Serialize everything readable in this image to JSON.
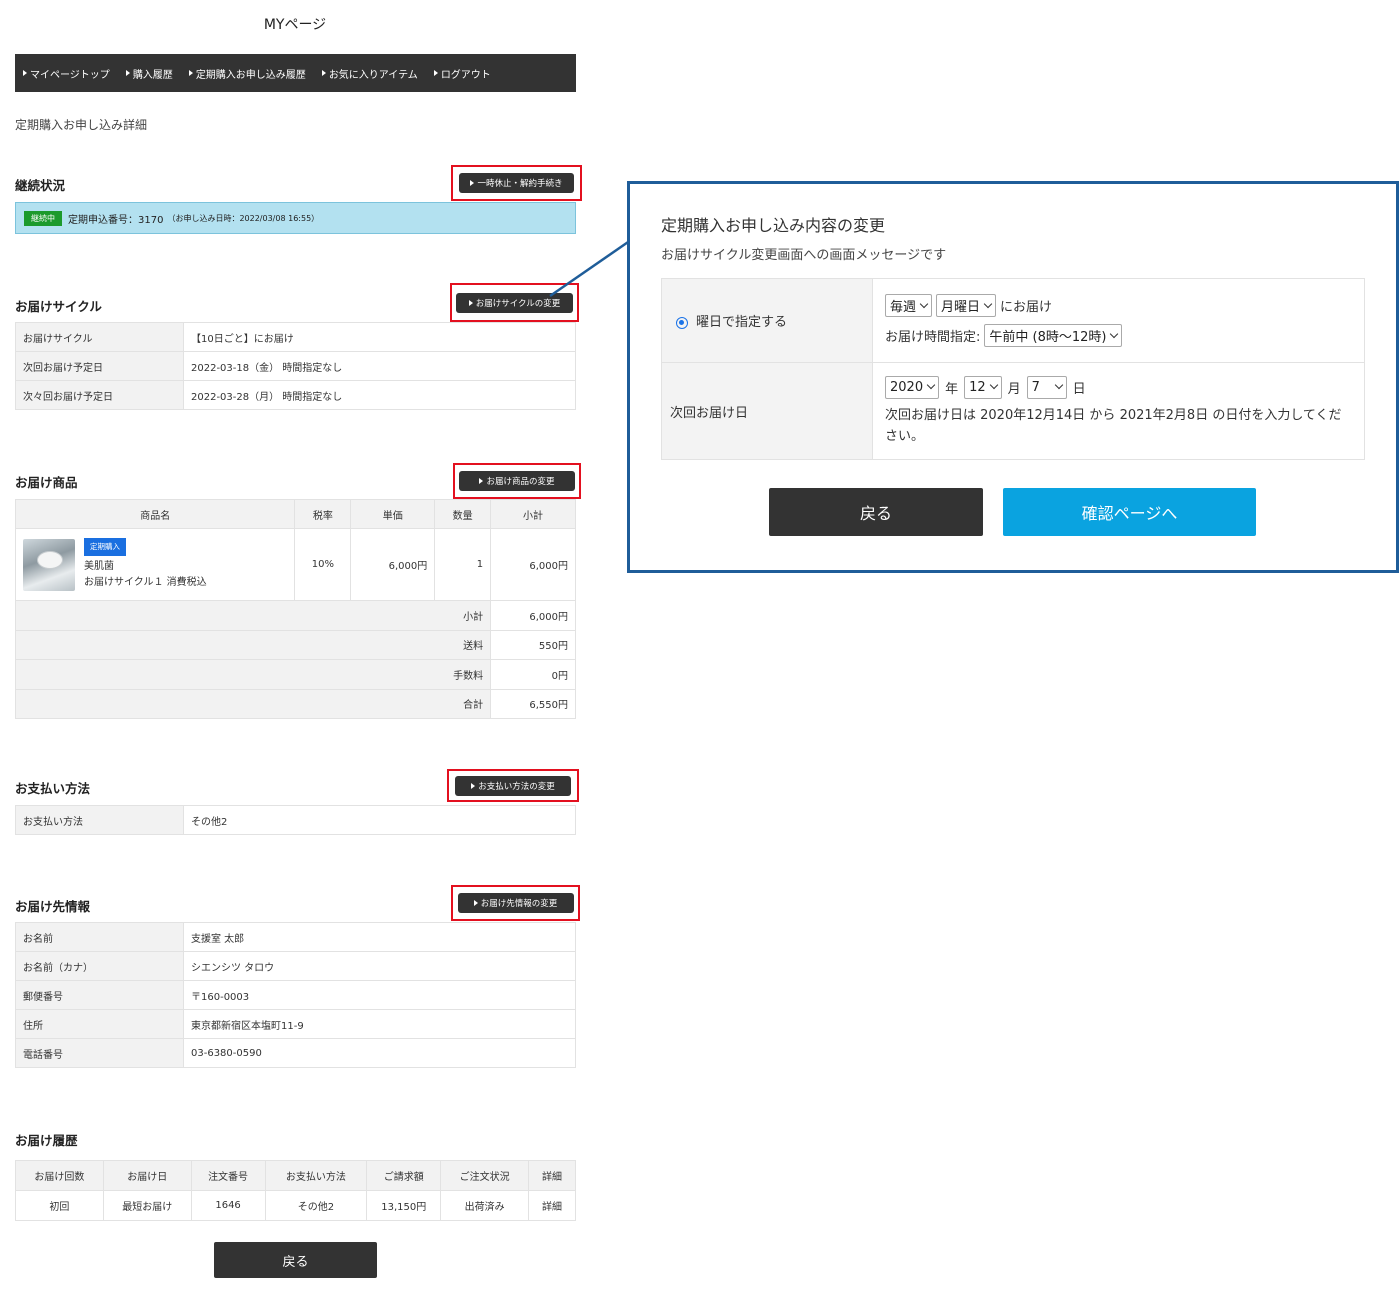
{
  "page_title": "MYページ",
  "nav": [
    "マイページトップ",
    "購入履歴",
    "定期購入お申し込み履歴",
    "お気に入りアイテム",
    "ログアウト"
  ],
  "subtitle": "定期購入お申し込み詳細",
  "status_section": {
    "title": "継続状況",
    "button": "一時休止・解約手続き",
    "badge": "継続中",
    "text": "定期申込番号：3170",
    "small": "（お申し込み日時：2022/03/08 16:55）"
  },
  "cycle_section": {
    "title": "お届けサイクル",
    "button": "お届けサイクルの変更",
    "rows": [
      {
        "k": "お届けサイクル",
        "v": "【10日ごと】にお届け"
      },
      {
        "k": "次回お届け予定日",
        "v": "2022-03-18（金） 時間指定なし"
      },
      {
        "k": "次々回お届け予定日",
        "v": "2022-03-28（月） 時間指定なし"
      }
    ]
  },
  "product_section": {
    "title": "お届け商品",
    "button": "お届け商品の変更",
    "headers": [
      "商品名",
      "税率",
      "単価",
      "数量",
      "小計"
    ],
    "item": {
      "badge": "定期購入",
      "name": "美肌菌",
      "sub": "お届けサイクル１ 消費税込",
      "tax": "10%",
      "price": "6,000円",
      "qty": "1",
      "subtotal": "6,000円"
    },
    "sums": [
      {
        "label": "小計",
        "value": "6,000円"
      },
      {
        "label": "送料",
        "value": "550円"
      },
      {
        "label": "手数料",
        "value": "0円"
      },
      {
        "label": "合計",
        "value": "6,550円"
      }
    ]
  },
  "payment_section": {
    "title": "お支払い方法",
    "button": "お支払い方法の変更",
    "rows": [
      {
        "k": "お支払い方法",
        "v": "その他2"
      }
    ]
  },
  "address_section": {
    "title": "お届け先情報",
    "button": "お届け先情報の変更",
    "rows": [
      {
        "k": "お名前",
        "v": "支援室 太郎"
      },
      {
        "k": "お名前（カナ）",
        "v": "シエンシツ タロウ"
      },
      {
        "k": "郵便番号",
        "v": "〒160-0003"
      },
      {
        "k": "住所",
        "v": "東京都新宿区本塩町11-9"
      },
      {
        "k": "電話番号",
        "v": "03-6380-0590"
      }
    ]
  },
  "history_section": {
    "title": "お届け履歴",
    "headers": [
      "お届け回数",
      "お届け日",
      "注文番号",
      "お支払い方法",
      "ご請求額",
      "ご注文状況",
      "詳細"
    ],
    "row": [
      "初回",
      "最短お届け",
      "1646",
      "その他2",
      "13,150円",
      "出荷済み",
      "詳細"
    ]
  },
  "back_button": "戻る",
  "modal": {
    "title": "定期購入お申し込み内容の変更",
    "message": "お届けサイクル変更画面への画面メッセージです",
    "radio_label": "曜日で指定する",
    "every": "毎週",
    "weekday": "月曜日",
    "deliver_suffix": "にお届け",
    "time_label": "お届け時間指定:",
    "time_value": "午前中 (8時〜12時)",
    "next_label": "次回お届け日",
    "year": "2020",
    "year_unit": "年",
    "month": "12",
    "month_unit": "月",
    "day": "7",
    "day_unit": "日",
    "note": "次回お届け日は 2020年12月14日 から 2021年2月8日 の日付を入力してください。",
    "back": "戻る",
    "confirm": "確認ページへ"
  },
  "colors": {
    "nav_bg": "#333333",
    "highlight": "#e3101f",
    "modal_border": "#1f5d99",
    "confirm": "#0aa3e0",
    "status_bg": "#b3e1f0"
  }
}
